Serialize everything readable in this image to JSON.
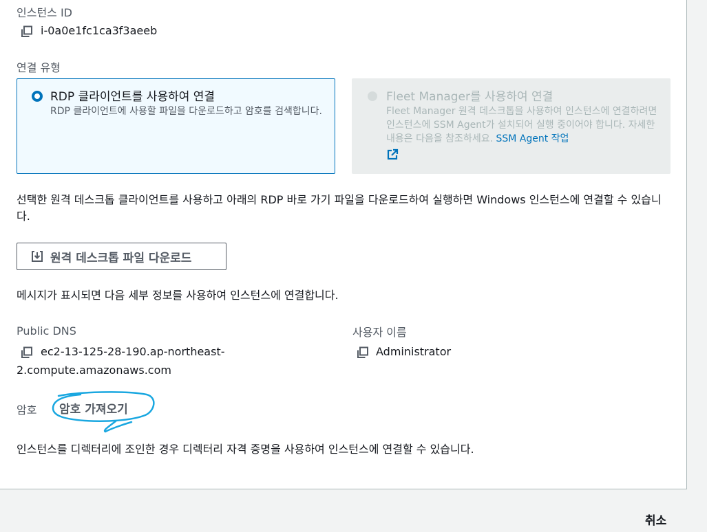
{
  "instance": {
    "id_label": "인스턴스 ID",
    "id_value": "i-0a0e1fc1ca3f3aeeb"
  },
  "connection_type": {
    "label": "연결 유형",
    "options": [
      {
        "title": "RDP 클라이언트를 사용하여 연결",
        "description": "RDP 클라이언트에 사용할 파일을 다운로드하고 암호를 검색합니다.",
        "selected": true
      },
      {
        "title": "Fleet Manager를 사용하여 연결",
        "description": "Fleet Manager 원격 데스크톱을 사용하여 인스턴스에 연결하려면 인스턴스에 SSM Agent가 설치되어 실행 중이어야 합니다. 자세한 내용은 다음을 참조하세요.",
        "link_text": "SSM Agent 작업",
        "selected": false,
        "disabled": true
      }
    ]
  },
  "rdp_intro": "선택한 원격 데스크톱 클라이언트를 사용하고 아래의 RDP 바로 가기 파일을 다운로드하여 실행하면 Windows 인스턴스에 연결할 수 있습니다.",
  "download_button": "원격 데스크톱 파일 다운로드",
  "prompt_text": "메시지가 표시되면 다음 세부 정보를 사용하여 인스턴스에 연결합니다.",
  "public_dns": {
    "label": "Public DNS",
    "value_line1": "ec2-13-125-28-190.ap-northeast-",
    "value_line2": "2.compute.amazonaws.com"
  },
  "username": {
    "label": "사용자 이름",
    "value": "Administrator"
  },
  "password": {
    "label": "암호",
    "action": "암호 가져오기"
  },
  "directory_note": "인스턴스를 디렉터리에 조인한 경우 디렉터리 자격 증명을 사용하여 인스턴스에 연결할 수 있습니다.",
  "footer": {
    "cancel": "취소"
  },
  "colors": {
    "accent": "#0073bb",
    "annotation": "#19a7e0",
    "disabled": "#aab7b8"
  }
}
